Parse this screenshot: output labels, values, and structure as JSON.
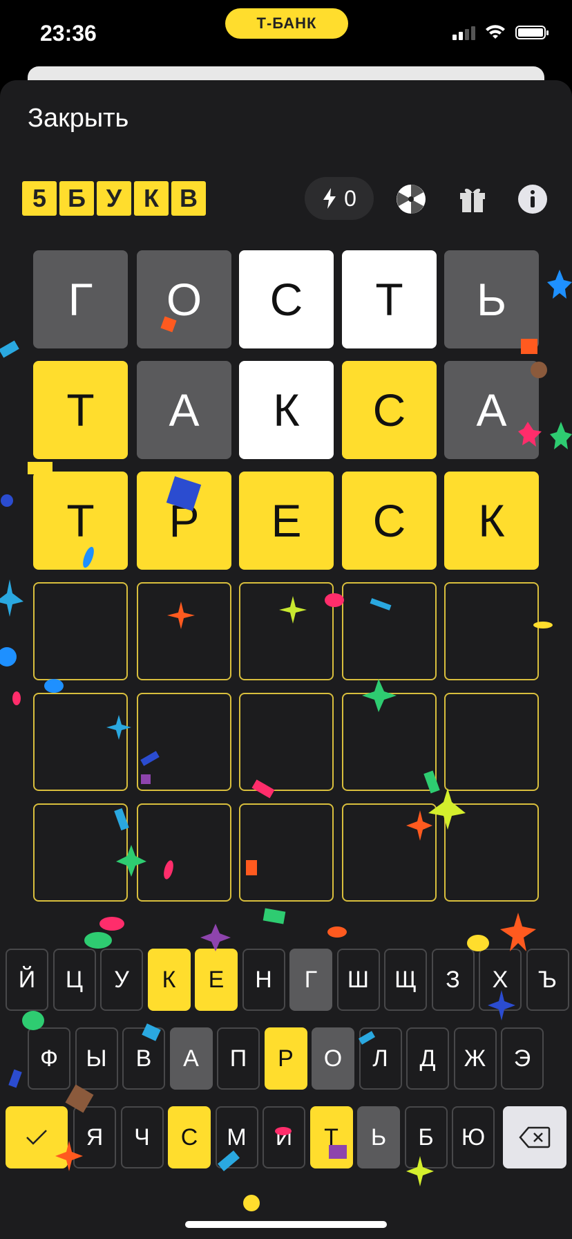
{
  "status_bar": {
    "time": "23:36",
    "bank_label": "Т-БАНК"
  },
  "header": {
    "close_label": "Закрыть",
    "logo_letters": [
      "5",
      "Б",
      "У",
      "К",
      "В"
    ],
    "energy_count": "0",
    "icons": [
      "lightning-icon",
      "wheel-icon",
      "gift-icon",
      "info-icon"
    ]
  },
  "board": {
    "rows": [
      [
        {
          "letter": "Г",
          "state": "gray"
        },
        {
          "letter": "О",
          "state": "gray"
        },
        {
          "letter": "С",
          "state": "white"
        },
        {
          "letter": "Т",
          "state": "white"
        },
        {
          "letter": "Ь",
          "state": "gray"
        }
      ],
      [
        {
          "letter": "Т",
          "state": "yellow"
        },
        {
          "letter": "А",
          "state": "gray"
        },
        {
          "letter": "К",
          "state": "white"
        },
        {
          "letter": "С",
          "state": "yellow"
        },
        {
          "letter": "А",
          "state": "gray"
        }
      ],
      [
        {
          "letter": "Т",
          "state": "yellow"
        },
        {
          "letter": "Р",
          "state": "yellow"
        },
        {
          "letter": "Е",
          "state": "yellow"
        },
        {
          "letter": "С",
          "state": "yellow"
        },
        {
          "letter": "К",
          "state": "yellow"
        }
      ],
      [
        {
          "letter": "",
          "state": "empty"
        },
        {
          "letter": "",
          "state": "empty"
        },
        {
          "letter": "",
          "state": "empty"
        },
        {
          "letter": "",
          "state": "empty"
        },
        {
          "letter": "",
          "state": "empty"
        }
      ],
      [
        {
          "letter": "",
          "state": "empty"
        },
        {
          "letter": "",
          "state": "empty"
        },
        {
          "letter": "",
          "state": "empty"
        },
        {
          "letter": "",
          "state": "empty"
        },
        {
          "letter": "",
          "state": "empty"
        }
      ],
      [
        {
          "letter": "",
          "state": "empty"
        },
        {
          "letter": "",
          "state": "empty"
        },
        {
          "letter": "",
          "state": "empty"
        },
        {
          "letter": "",
          "state": "empty"
        },
        {
          "letter": "",
          "state": "empty"
        }
      ]
    ]
  },
  "keyboard": {
    "row1": [
      {
        "label": "Й",
        "state": "default"
      },
      {
        "label": "Ц",
        "state": "default"
      },
      {
        "label": "У",
        "state": "default"
      },
      {
        "label": "К",
        "state": "yellow"
      },
      {
        "label": "Е",
        "state": "yellow"
      },
      {
        "label": "Н",
        "state": "default"
      },
      {
        "label": "Г",
        "state": "gray"
      },
      {
        "label": "Ш",
        "state": "default"
      },
      {
        "label": "Щ",
        "state": "default"
      },
      {
        "label": "З",
        "state": "default"
      },
      {
        "label": "Х",
        "state": "default"
      },
      {
        "label": "Ъ",
        "state": "default"
      }
    ],
    "row2": [
      {
        "label": "Ф",
        "state": "default"
      },
      {
        "label": "Ы",
        "state": "default"
      },
      {
        "label": "В",
        "state": "default"
      },
      {
        "label": "А",
        "state": "gray"
      },
      {
        "label": "П",
        "state": "default"
      },
      {
        "label": "Р",
        "state": "yellow"
      },
      {
        "label": "О",
        "state": "gray"
      },
      {
        "label": "Л",
        "state": "default"
      },
      {
        "label": "Д",
        "state": "default"
      },
      {
        "label": "Ж",
        "state": "default"
      },
      {
        "label": "Э",
        "state": "default"
      }
    ],
    "row3": [
      {
        "label": "Я",
        "state": "default"
      },
      {
        "label": "Ч",
        "state": "default"
      },
      {
        "label": "С",
        "state": "yellow"
      },
      {
        "label": "М",
        "state": "default"
      },
      {
        "label": "И",
        "state": "default"
      },
      {
        "label": "Т",
        "state": "yellow"
      },
      {
        "label": "Ь",
        "state": "gray"
      },
      {
        "label": "Б",
        "state": "default"
      },
      {
        "label": "Ю",
        "state": "default"
      }
    ],
    "enter_icon": "checkmark-icon",
    "backspace_icon": "backspace-icon"
  },
  "colors": {
    "accent_yellow": "#ffdd2d",
    "tile_gray": "#5a5a5c",
    "tile_white": "#ffffff",
    "sheet_bg": "#1c1c1e"
  }
}
